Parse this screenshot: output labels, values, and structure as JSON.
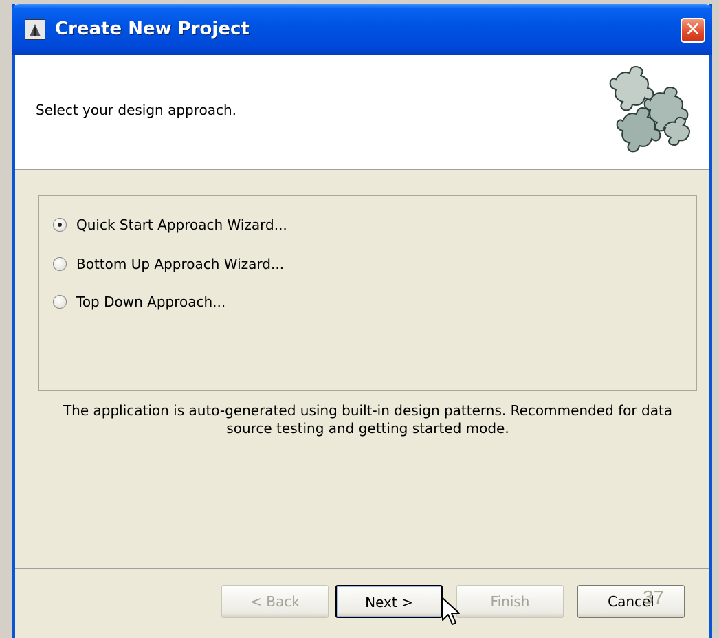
{
  "window": {
    "title": "Create New Project",
    "close_glyph": "✕"
  },
  "header": {
    "instruction": "Select your design approach."
  },
  "options": [
    {
      "label": "Quick Start Approach Wizard...",
      "selected": true
    },
    {
      "label": "Bottom Up Approach Wizard...",
      "selected": false
    },
    {
      "label": "Top Down Approach...",
      "selected": false
    }
  ],
  "description": "The application is auto-generated using built-in design patterns. Recommended for data source testing and getting started mode.",
  "buttons": {
    "back": "< Back",
    "next": "Next >",
    "finish": "Finish",
    "cancel": "Cancel"
  },
  "slide_page_number": "37",
  "colors": {
    "titlebar": "#0054e3",
    "dialog_bg": "#ece9d8",
    "close_button": "#e04a2a"
  },
  "icons": [
    "app-icon",
    "close-icon",
    "puzzle-pieces-icon",
    "radio-button",
    "mouse-cursor-icon"
  ]
}
